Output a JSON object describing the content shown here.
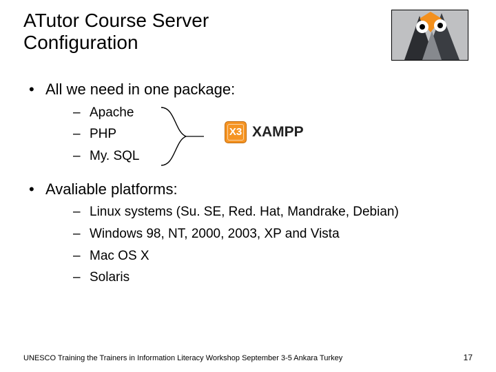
{
  "title": "ATutor Course Server Configuration",
  "xampp_label": "XAMPP",
  "xampp_icon_glyph": "X3",
  "bullets": [
    {
      "label": "All we need in one package:",
      "sub": [
        "Apache",
        "PHP",
        "My. SQL"
      ]
    },
    {
      "label": "Avaliable platforms:",
      "sub": [
        "Linux systems (Su. SE, Red. Hat, Mandrake, Debian)",
        "Windows 98, NT, 2000, 2003, XP and Vista",
        "Mac OS X",
        "Solaris"
      ]
    }
  ],
  "footer_text": "UNESCO Training the Trainers in Information Literacy Workshop September 3-5 Ankara Turkey",
  "page_number": "17"
}
